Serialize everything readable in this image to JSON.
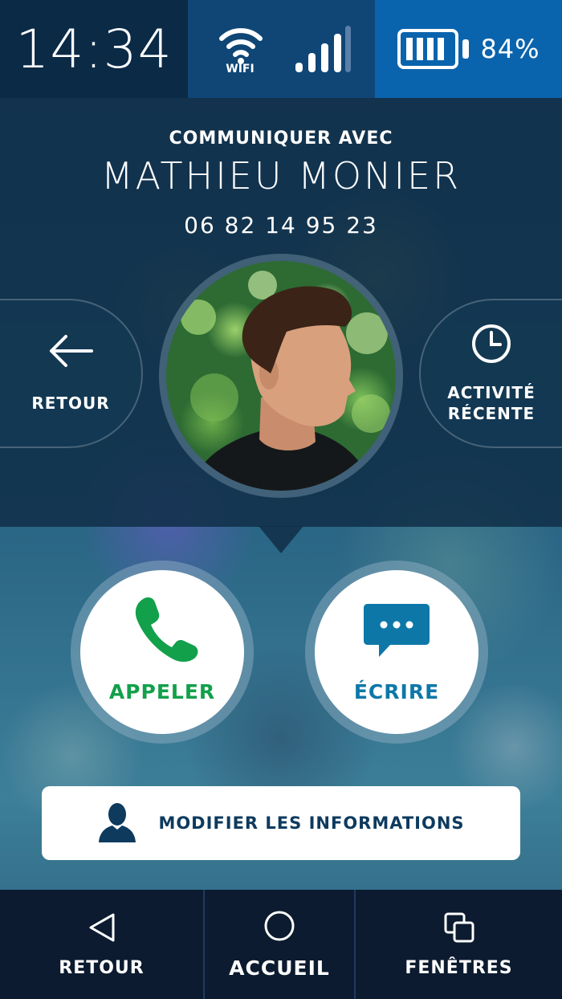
{
  "status_bar": {
    "time": "14:34",
    "wifi_label": "WIFI",
    "battery_percent": "84%",
    "signal_bars": 4,
    "colors": {
      "time_bg": "#0b2a46",
      "network_bg": "#0f4676",
      "battery_bg": "#0a63ad"
    }
  },
  "contact": {
    "subtitle": "COMMUNIQUER AVEC",
    "name": "MATHIEU MONIER",
    "phone": "06 82 14 95 23",
    "avatar_icon": "contact-photo"
  },
  "side_buttons": {
    "back": {
      "label": "RETOUR",
      "icon": "arrow-left-icon"
    },
    "activity": {
      "label_line1": "ACTIVITÉ",
      "label_line2": "RÉCENTE",
      "icon": "clock-icon"
    }
  },
  "actions": {
    "call": {
      "label": "APPELER",
      "icon": "phone-icon",
      "color": "#12a04b"
    },
    "write": {
      "label": "ÉCRIRE",
      "icon": "chat-bubble-icon",
      "color": "#0d78a8"
    }
  },
  "edit_button": {
    "label": "MODIFIER LES INFORMATIONS",
    "icon": "person-icon",
    "color": "#0e3a5e"
  },
  "nav": {
    "back": {
      "label": "RETOUR",
      "icon": "triangle-back-icon"
    },
    "home": {
      "label": "ACCUEIL",
      "icon": "circle-home-icon"
    },
    "windows": {
      "label": "FENÊTRES",
      "icon": "overlapping-squares-icon"
    }
  }
}
